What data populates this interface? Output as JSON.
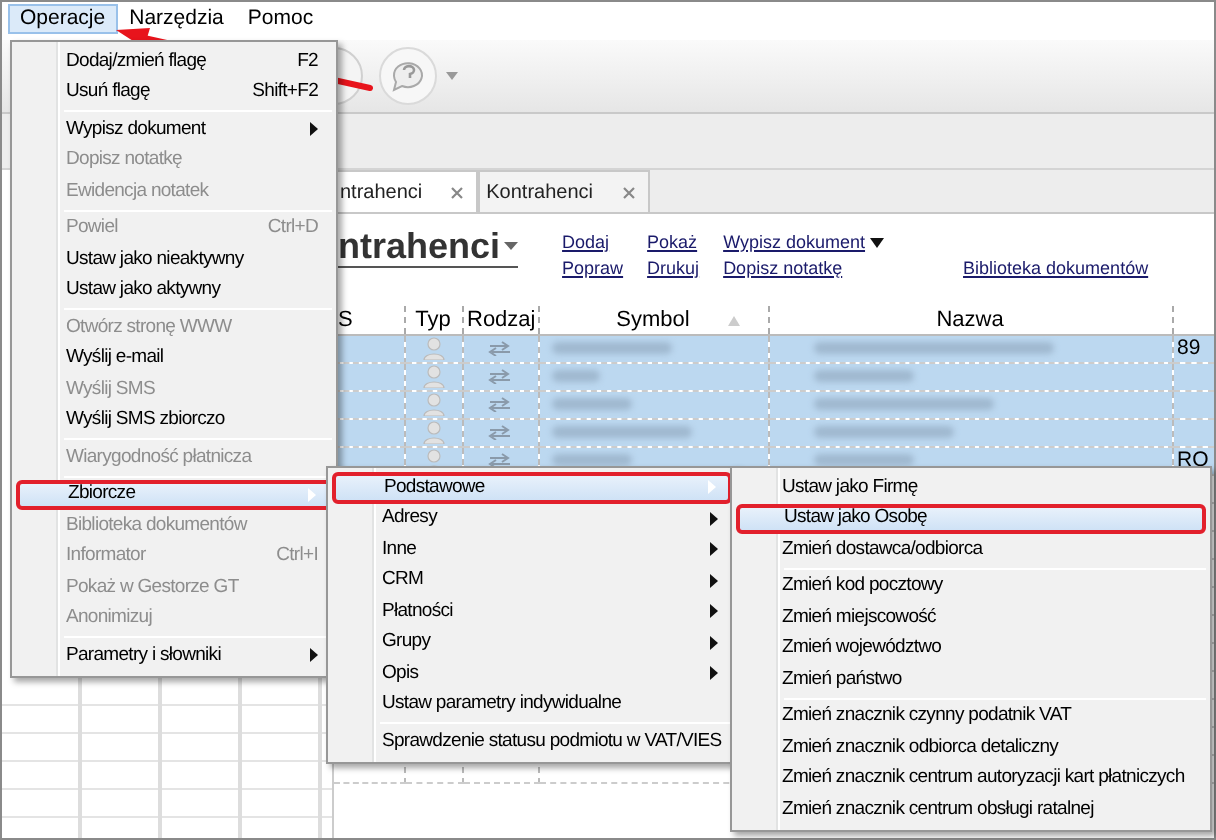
{
  "menubar": [
    {
      "label": "Operacje",
      "selected": true
    },
    {
      "label": "Narzędzia",
      "selected": false
    },
    {
      "label": "Pomoc",
      "selected": false
    }
  ],
  "tabs": [
    {
      "label": "ntrahenci",
      "selected": true
    },
    {
      "label": "Kontrahenci",
      "selected": false
    }
  ],
  "page_title": "ntrahenci",
  "actions": [
    {
      "items": [
        {
          "label": "Dodaj"
        },
        {
          "label": "Popraw"
        }
      ]
    },
    {
      "items": [
        {
          "label": "Pokaż"
        },
        {
          "label": "Drukuj"
        }
      ]
    },
    {
      "items": [
        {
          "label": "Wypisz dokument",
          "dropdown": true
        },
        {
          "label": "Dopisz notatkę"
        }
      ]
    },
    {
      "items": [
        {
          "label": "Biblioteka dokumentów"
        }
      ]
    }
  ],
  "table": {
    "columns": [
      {
        "label": "S"
      },
      {
        "label": "Typ"
      },
      {
        "label": "Rodzaj"
      },
      {
        "label": "Symbol",
        "sorted": true
      },
      {
        "label": "Nazwa"
      }
    ],
    "rows": [
      {
        "selected": true,
        "column_6": "89"
      },
      {
        "selected": true
      },
      {
        "selected": true
      },
      {
        "selected": true
      },
      {
        "selected": true,
        "column_6": "RO"
      },
      {
        "selected": false
      },
      {
        "selected": false
      },
      {
        "selected": false
      },
      {
        "selected": false
      },
      {
        "selected": false
      },
      {
        "selected": false
      },
      {
        "selected": false
      },
      {
        "selected": false
      },
      {
        "selected": false
      },
      {
        "selected": false
      },
      {
        "selected": false
      }
    ]
  },
  "menus": [
    {
      "items": [
        {
          "kind": "item",
          "label": "Dodaj/zmień flagę",
          "shortcut": "F2",
          "disabled": false
        },
        {
          "kind": "item",
          "label": "Usuń flagę",
          "shortcut": "Shift+F2",
          "disabled": false
        },
        {
          "kind": "separator"
        },
        {
          "kind": "item",
          "label": "Wypisz dokument",
          "submenu": true,
          "disabled": false
        },
        {
          "kind": "item",
          "label": "Dopisz notatkę",
          "disabled": true
        },
        {
          "kind": "item",
          "label": "Ewidencja notatek",
          "disabled": true
        },
        {
          "kind": "separator"
        },
        {
          "kind": "item",
          "label": "Powiel",
          "shortcut": "Ctrl+D",
          "disabled": true
        },
        {
          "kind": "item",
          "label": "Ustaw jako nieaktywny",
          "disabled": false
        },
        {
          "kind": "item",
          "label": "Ustaw jako aktywny",
          "disabled": false
        },
        {
          "kind": "separator"
        },
        {
          "kind": "item",
          "label": "Otwórz stronę WWW",
          "disabled": true
        },
        {
          "kind": "item",
          "label": "Wyślij e-mail",
          "disabled": false
        },
        {
          "kind": "item",
          "label": "Wyślij SMS",
          "disabled": true
        },
        {
          "kind": "item",
          "label": "Wyślij SMS zbiorczo",
          "disabled": false
        },
        {
          "kind": "separator"
        },
        {
          "kind": "item",
          "label": "Wiarygodność płatnicza",
          "disabled": true
        },
        {
          "kind": "separator"
        },
        {
          "kind": "item",
          "label": "Zbiorcze",
          "submenu": true,
          "disabled": false,
          "selected": true,
          "annotated": true
        },
        {
          "kind": "item",
          "label": "Biblioteka dokumentów",
          "disabled": true
        },
        {
          "kind": "item",
          "label": "Informator",
          "shortcut": "Ctrl+I",
          "disabled": true
        },
        {
          "kind": "item",
          "label": "Pokaż w Gestorze GT",
          "disabled": true
        },
        {
          "kind": "item",
          "label": "Anonimizuj",
          "disabled": true
        },
        {
          "kind": "separator"
        },
        {
          "kind": "item",
          "label": "Parametry i słowniki",
          "submenu": true,
          "disabled": false
        }
      ]
    },
    {
      "items": [
        {
          "kind": "item",
          "label": "Podstawowe",
          "submenu": true,
          "disabled": false,
          "selected": true,
          "annotated": true
        },
        {
          "kind": "item",
          "label": "Adresy",
          "submenu": true,
          "disabled": false
        },
        {
          "kind": "item",
          "label": "Inne",
          "submenu": true,
          "disabled": false
        },
        {
          "kind": "item",
          "label": "CRM",
          "submenu": true,
          "disabled": false
        },
        {
          "kind": "item",
          "label": "Płatności",
          "submenu": true,
          "disabled": false
        },
        {
          "kind": "item",
          "label": "Grupy",
          "submenu": true,
          "disabled": false
        },
        {
          "kind": "item",
          "label": "Opis",
          "submenu": true,
          "disabled": false
        },
        {
          "kind": "item",
          "label": "Ustaw parametry indywidualne",
          "disabled": false
        },
        {
          "kind": "separator"
        },
        {
          "kind": "item",
          "label": "Sprawdzenie statusu podmiotu w VAT/VIES",
          "disabled": false
        }
      ]
    },
    {
      "items": [
        {
          "kind": "item",
          "label": "Ustaw jako Firmę",
          "disabled": false
        },
        {
          "kind": "item",
          "label": "Ustaw jako Osobę",
          "disabled": false,
          "selected": true,
          "annotated": true
        },
        {
          "kind": "item",
          "label": "Zmień dostawca/odbiorca",
          "disabled": false
        },
        {
          "kind": "separator"
        },
        {
          "kind": "item",
          "label": "Zmień kod pocztowy",
          "disabled": false
        },
        {
          "kind": "item",
          "label": "Zmień miejscowość",
          "disabled": false
        },
        {
          "kind": "item",
          "label": "Zmień województwo",
          "disabled": false
        },
        {
          "kind": "item",
          "label": "Zmień państwo",
          "disabled": false
        },
        {
          "kind": "separator"
        },
        {
          "kind": "item",
          "label": "Zmień znacznik czynny podatnik VAT",
          "disabled": false
        },
        {
          "kind": "item",
          "label": "Zmień znacznik odbiorca detaliczny",
          "disabled": false
        },
        {
          "kind": "item",
          "label": "Zmień znacznik centrum autoryzacji kart płatniczych",
          "disabled": false
        },
        {
          "kind": "item",
          "label": "Zmień znacznik centrum obsługi ratalnej",
          "disabled": false
        }
      ]
    }
  ]
}
